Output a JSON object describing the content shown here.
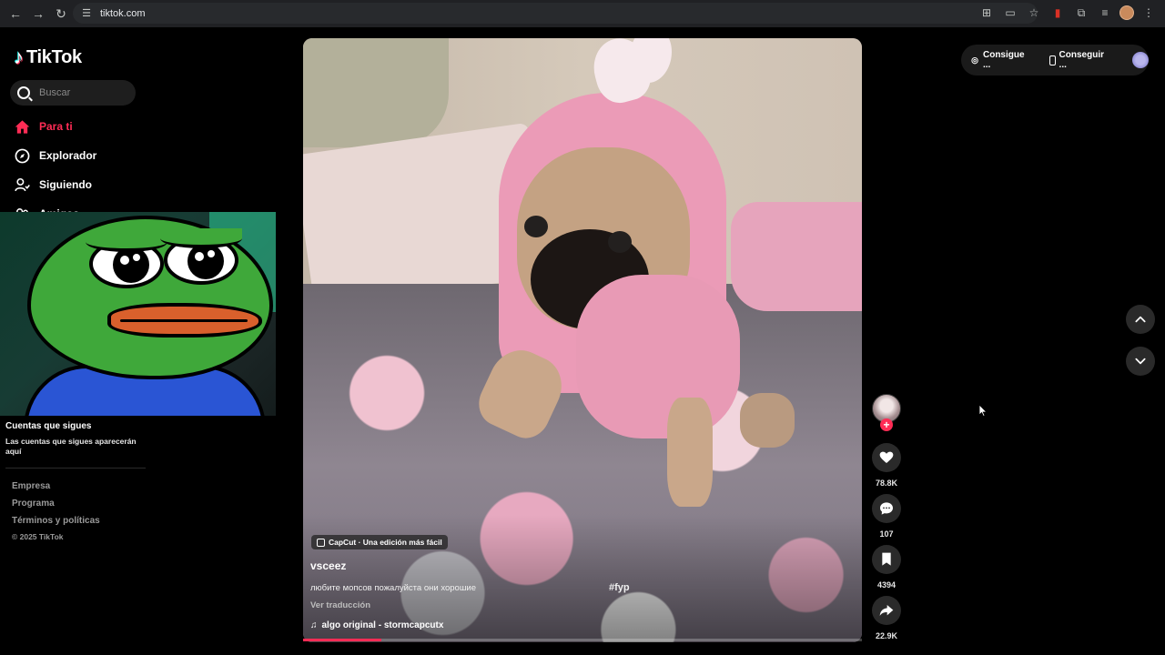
{
  "browser": {
    "url": "tiktok.com"
  },
  "sidebar": {
    "logo_text": "TikTok",
    "search_placeholder": "Buscar",
    "nav": [
      {
        "label": "Para ti",
        "icon": "home-icon",
        "active": true
      },
      {
        "label": "Explorador",
        "icon": "compass-icon"
      },
      {
        "label": "Siguiendo",
        "icon": "person-follow-icon"
      },
      {
        "label": "Amigos",
        "icon": "friends-icon"
      }
    ],
    "following_title": "Cuentas que sigues",
    "following_desc": "Las cuentas que sigues aparecerán aquí",
    "footer": {
      "company": "Empresa",
      "program": "Programa",
      "terms": "Términos y políticas",
      "copyright": "© 2025 TikTok"
    }
  },
  "video": {
    "badge": "CapCut · Una edición más fácil",
    "author": "vsceez",
    "caption": "любите мопсов пожалуйста они хорошие",
    "hashtag": "#fyp",
    "translate_label": "Ver traducción",
    "music": "algo original - stormcapcutx",
    "progress_fraction": 0.14
  },
  "actions": {
    "likes": "78.8K",
    "comments": "107",
    "saves": "4394",
    "shares": "22.9K"
  },
  "top_right": {
    "coins_label": "Consigue ...",
    "app_label": "Conseguir ..."
  },
  "colors": {
    "accent": "#fe2c55",
    "background": "#000000"
  }
}
